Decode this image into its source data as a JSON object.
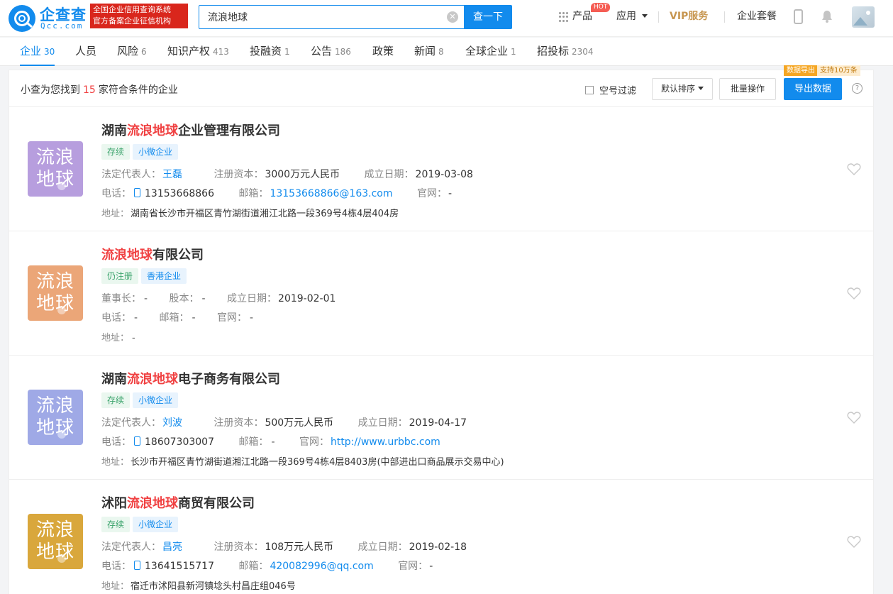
{
  "header": {
    "logo_text": "企查查",
    "logo_sub": "Qcc.com",
    "badge_line1": "全国企业信用查询系统",
    "badge_line2": "官方备案企业征信机构",
    "search_value": "流浪地球",
    "search_button": "查一下",
    "nav_product": "产品",
    "hot_badge": "HOT",
    "nav_apps": "应用",
    "vip": "VIP服务",
    "nav_package": "企业套餐"
  },
  "tabs": [
    {
      "label": "企业",
      "count": "30"
    },
    {
      "label": "人员",
      "count": ""
    },
    {
      "label": "风险",
      "count": "6"
    },
    {
      "label": "知识产权",
      "count": "413"
    },
    {
      "label": "投融资",
      "count": "1"
    },
    {
      "label": "公告",
      "count": "186"
    },
    {
      "label": "政策",
      "count": ""
    },
    {
      "label": "新闻",
      "count": "8"
    },
    {
      "label": "全球企业",
      "count": "1"
    },
    {
      "label": "招投标",
      "count": "2304"
    }
  ],
  "results": {
    "prefix": "小查为您找到",
    "count": "15",
    "suffix": "家符合条件的企业",
    "filter_label": "空号过滤",
    "sort_label": "默认排序",
    "batch_label": "批量操作",
    "export_label": "导出数据",
    "export_tip1": "数据导出",
    "export_tip2": "支持10万条",
    "help": "?"
  },
  "companies": [
    {
      "logo_line1": "流浪",
      "logo_line2": "地球",
      "logo_color": "#b79ede",
      "name_pre": "湖南",
      "name_hl": "流浪地球",
      "name_post": "企业管理有限公司",
      "tag1": "存续",
      "tag2": "小微企业",
      "f1_label": "法定代表人：",
      "f1_value": "王磊",
      "f2_label": "注册资本：",
      "f2_value": "3000万元人民币",
      "f3_label": "成立日期：",
      "f3_value": "2019-03-08",
      "phone_label": "电话：",
      "phone": "13153668866",
      "email_label": "邮箱：",
      "email": "13153668866@163.com",
      "web_label": "官网：",
      "web": "-",
      "addr_label": "地址：",
      "addr": "湖南省长沙市开福区青竹湖街道湘江北路一段369号4栋4层404房"
    },
    {
      "logo_line1": "流浪",
      "logo_line2": "地球",
      "logo_color": "#eba678",
      "name_pre": "",
      "name_hl": "流浪地球",
      "name_post": "有限公司",
      "tag1": "仍注册",
      "tag2": "香港企业",
      "f1_label": "董事长：",
      "f1_value": "-",
      "f2_label": "股本：",
      "f2_value": "-",
      "f3_label": "成立日期：",
      "f3_value": "2019-02-01",
      "phone_label": "电话：",
      "phone": "-",
      "email_label": "邮箱：",
      "email": "-",
      "web_label": "官网：",
      "web": "-",
      "addr_label": "地址：",
      "addr": "-"
    },
    {
      "logo_line1": "流浪",
      "logo_line2": "地球",
      "logo_color": "#9fa9e6",
      "name_pre": "湖南",
      "name_hl": "流浪地球",
      "name_post": "电子商务有限公司",
      "tag1": "存续",
      "tag2": "小微企业",
      "f1_label": "法定代表人：",
      "f1_value": "刘波",
      "f2_label": "注册资本：",
      "f2_value": "500万元人民币",
      "f3_label": "成立日期：",
      "f3_value": "2019-04-17",
      "phone_label": "电话：",
      "phone": "18607303007",
      "email_label": "邮箱：",
      "email": "-",
      "web_label": "官网：",
      "web": "http://www.urbbc.com",
      "addr_label": "地址：",
      "addr": "长沙市开福区青竹湖街道湘江北路一段369号4栋4层8403房(中部进出口商品展示交易中心)"
    },
    {
      "logo_line1": "流浪",
      "logo_line2": "地球",
      "logo_color": "#d9a73c",
      "name_pre": "沭阳",
      "name_hl": "流浪地球",
      "name_post": "商贸有限公司",
      "tag1": "存续",
      "tag2": "小微企业",
      "f1_label": "法定代表人：",
      "f1_value": "昌亮",
      "f2_label": "注册资本：",
      "f2_value": "108万元人民币",
      "f3_label": "成立日期：",
      "f3_value": "2019-02-18",
      "phone_label": "电话：",
      "phone": "13641515717",
      "email_label": "邮箱：",
      "email": "420082996@qq.com",
      "web_label": "官网：",
      "web": "-",
      "addr_label": "地址：",
      "addr": "宿迁市沭阳县新河镇埝头村昌庄组046号"
    }
  ]
}
